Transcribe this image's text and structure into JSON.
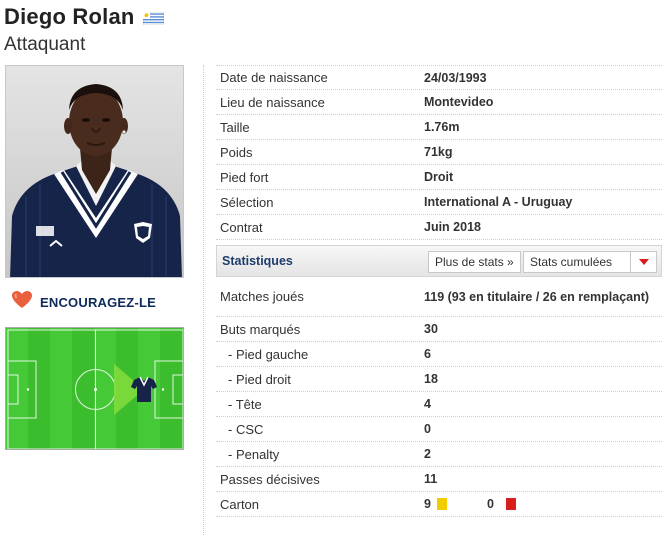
{
  "player": {
    "name": "Diego Rolan",
    "position": "Attaquant"
  },
  "encourage": {
    "label": "ENCOURAGEZ-LE"
  },
  "info_rows": [
    {
      "label": "Date de naissance",
      "value": "24/03/1993"
    },
    {
      "label": "Lieu de naissance",
      "value": "Montevideo"
    },
    {
      "label": "Taille",
      "value": "1.76m"
    },
    {
      "label": "Poids",
      "value": "71kg"
    },
    {
      "label": "Pied fort",
      "value": "Droit"
    },
    {
      "label": "Sélection",
      "value": "International A - Uruguay"
    },
    {
      "label": "Contrat",
      "value": "Juin 2018"
    }
  ],
  "stats": {
    "title": "Statistiques",
    "more_button": "Plus de stats »",
    "select_value": "Stats cumulées",
    "rows": [
      {
        "label": "Matches joués",
        "value": "119 (93 en titulaire / 26 en remplaçant)"
      },
      {
        "label": "Buts marqués",
        "value": "30"
      },
      {
        "label": "- Pied gauche",
        "value": "6"
      },
      {
        "label": "- Pied droit",
        "value": "18"
      },
      {
        "label": "- Tête",
        "value": "4"
      },
      {
        "label": "- CSC",
        "value": "0"
      },
      {
        "label": "- Penalty",
        "value": "2"
      },
      {
        "label": "Passes décisives",
        "value": "11"
      }
    ],
    "cards": {
      "label": "Carton",
      "yellow": "9",
      "red": "0"
    }
  },
  "colors": {
    "accent_navy": "#1e3d6b",
    "pitch_green": "#3cbd2e",
    "yellow_card": "#f3cc00",
    "red_card": "#d91c1c",
    "heart": "#e8603c"
  }
}
